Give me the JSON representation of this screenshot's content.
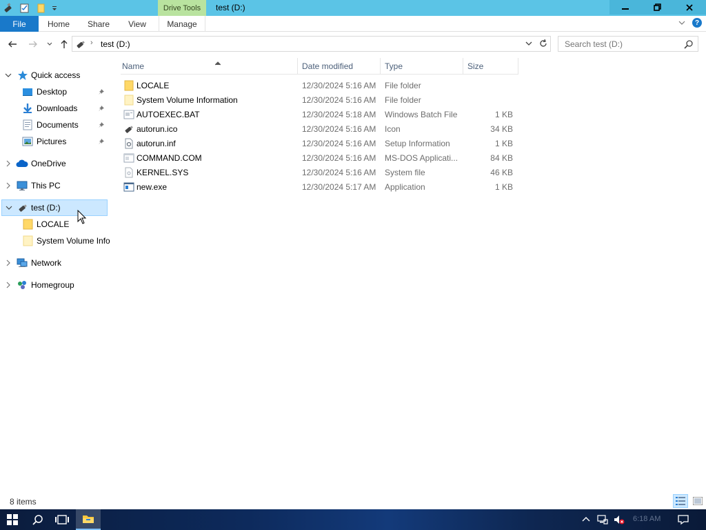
{
  "titlebar": {
    "context_tab": "Drive Tools",
    "title": "test (D:)"
  },
  "ribbon": {
    "tabs": {
      "file": "File",
      "home": "Home",
      "share": "Share",
      "view": "View",
      "manage": "Manage"
    },
    "help": "?"
  },
  "navigation": {
    "address": "test (D:)",
    "search_placeholder": "Search test (D:)"
  },
  "sidebar": {
    "quick_access": "Quick access",
    "desktop": "Desktop",
    "downloads": "Downloads",
    "documents": "Documents",
    "pictures": "Pictures",
    "onedrive": "OneDrive",
    "this_pc": "This PC",
    "drive": "test (D:)",
    "locale": "LOCALE",
    "svi": "System Volume Information",
    "network": "Network",
    "homegroup": "Homegroup"
  },
  "columns": {
    "name": "Name",
    "date": "Date modified",
    "type": "Type",
    "size": "Size"
  },
  "files": [
    {
      "name": "LOCALE",
      "date": "12/30/2024 5:16 AM",
      "type": "File folder",
      "size": "",
      "icon": "folder-icon"
    },
    {
      "name": "System Volume Information",
      "date": "12/30/2024 5:16 AM",
      "type": "File folder",
      "size": "",
      "icon": "folder-icon"
    },
    {
      "name": "AUTOEXEC.BAT",
      "date": "12/30/2024 5:18 AM",
      "type": "Windows Batch File",
      "size": "1 KB",
      "icon": "batch-file-icon"
    },
    {
      "name": "autorun.ico",
      "date": "12/30/2024 5:16 AM",
      "type": "Icon",
      "size": "34 KB",
      "icon": "usb-drive-icon"
    },
    {
      "name": "autorun.inf",
      "date": "12/30/2024 5:16 AM",
      "type": "Setup Information",
      "size": "1 KB",
      "icon": "settings-file-icon"
    },
    {
      "name": "COMMAND.COM",
      "date": "12/30/2024 5:16 AM",
      "type": "MS-DOS Applicati...",
      "size": "84 KB",
      "icon": "dos-app-icon"
    },
    {
      "name": "KERNEL.SYS",
      "date": "12/30/2024 5:16 AM",
      "type": "System file",
      "size": "46 KB",
      "icon": "system-file-icon"
    },
    {
      "name": "new.exe",
      "date": "12/30/2024 5:17 AM",
      "type": "Application",
      "size": "1 KB",
      "icon": "application-icon"
    }
  ],
  "status": {
    "item_count": "8 items"
  },
  "taskbar": {
    "clock": "6:18 AM"
  },
  "colors": {
    "titlebar": "#5bc4e6",
    "context_tab": "#b9e39f",
    "file_tab": "#1979ca",
    "selection": "#cce8ff",
    "selection_border": "#99d1ff",
    "folder": "#ffd867"
  }
}
